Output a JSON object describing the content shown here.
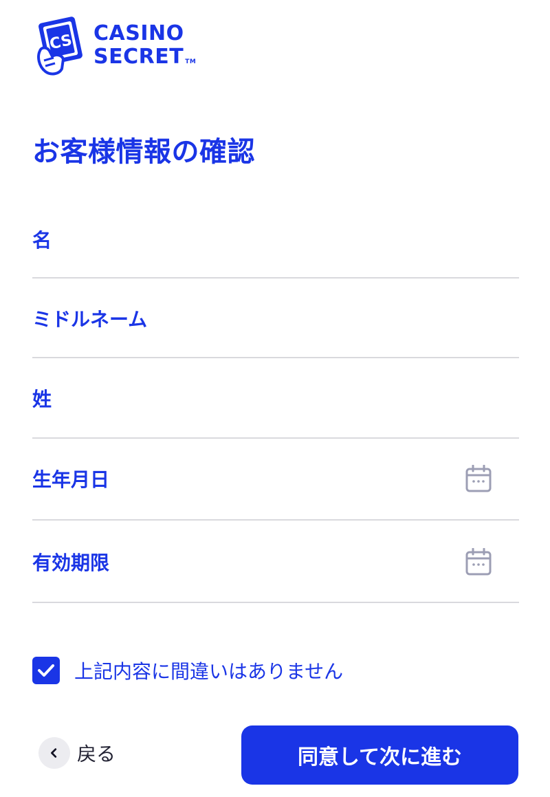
{
  "brand": {
    "logo_line1": "CASINO",
    "logo_line2": "SECRET",
    "trademark": "TM",
    "logo_icon": "card-hand-icon",
    "color": "#1a35e6"
  },
  "page": {
    "title": "お客様情報の確認"
  },
  "form": {
    "fields": [
      {
        "label": "名",
        "icon": ""
      },
      {
        "label": "ミドルネーム",
        "icon": ""
      },
      {
        "label": "姓",
        "icon": ""
      },
      {
        "label": "生年月日",
        "icon": "calendar-icon"
      },
      {
        "label": "有効期限",
        "icon": "calendar-icon"
      }
    ],
    "confirmation": {
      "label": "上記内容に間違いはありません",
      "checked": true
    }
  },
  "actions": {
    "back_label": "戻る",
    "back_icon": "chevron-left-icon",
    "next_label": "同意して次に進む"
  }
}
